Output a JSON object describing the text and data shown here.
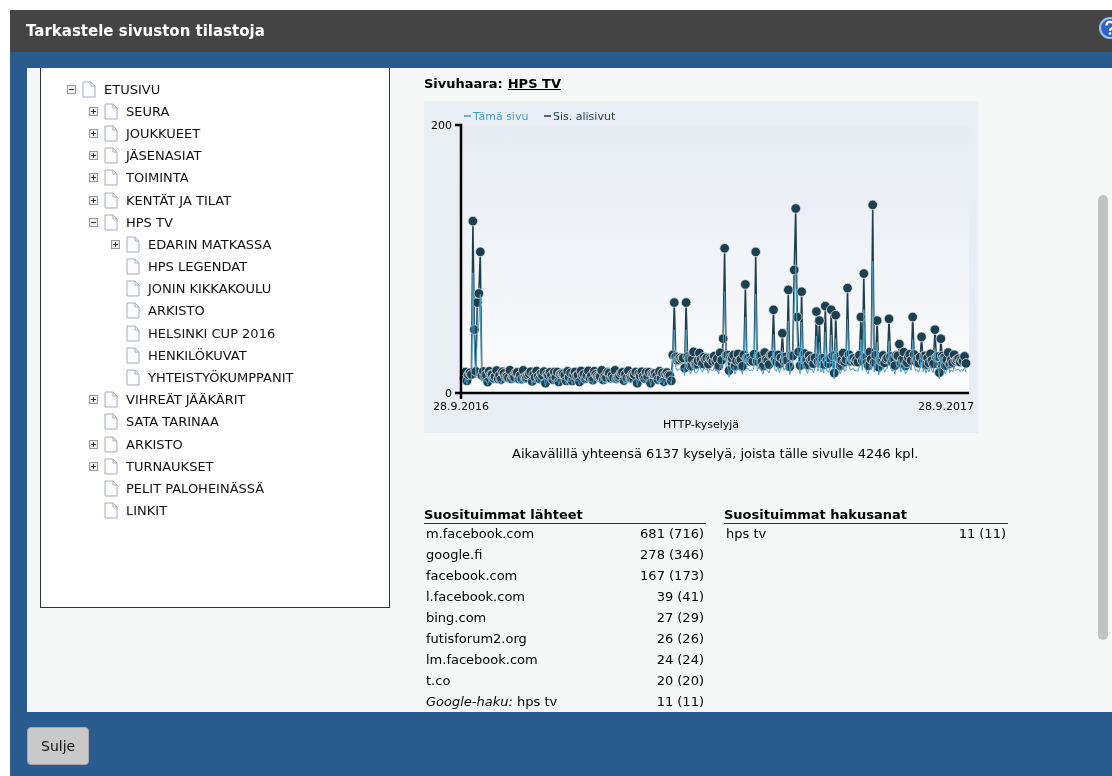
{
  "window": {
    "title": "Tarkastele sivuston tilastoja"
  },
  "tree": [
    {
      "label": "ETUSIVU",
      "kind": "folder",
      "expanded": true,
      "children": [
        {
          "label": "SEURA",
          "kind": "folder",
          "expanded": false
        },
        {
          "label": "JOUKKUEET",
          "kind": "folder",
          "expanded": false
        },
        {
          "label": "JÄSENASIAT",
          "kind": "folder",
          "expanded": false
        },
        {
          "label": "TOIMINTA",
          "kind": "folder",
          "expanded": false
        },
        {
          "label": "KENTÄT JA TILAT",
          "kind": "folder",
          "expanded": false
        },
        {
          "label": "HPS TV",
          "kind": "folder",
          "expanded": true,
          "children": [
            {
              "label": "EDARIN MATKASSA",
              "kind": "folder",
              "expanded": false
            },
            {
              "label": "HPS LEGENDAT",
              "kind": "page"
            },
            {
              "label": "JONIN KIKKAKOULU",
              "kind": "page"
            },
            {
              "label": "ARKISTO",
              "kind": "page"
            },
            {
              "label": "HELSINKI CUP 2016",
              "kind": "page"
            },
            {
              "label": "HENKILÖKUVAT",
              "kind": "page"
            },
            {
              "label": "YHTEISTYÖKUMPPANIT",
              "kind": "page"
            }
          ]
        },
        {
          "label": "VIHREÄT JÄÄKÄRIT",
          "kind": "folder",
          "expanded": false
        },
        {
          "label": "SATA TARINAA",
          "kind": "page"
        },
        {
          "label": "ARKISTO",
          "kind": "folder",
          "expanded": false
        },
        {
          "label": "TURNAUKSET",
          "kind": "folder",
          "expanded": false
        },
        {
          "label": "PELIT PALOHEINÄSSÄ",
          "kind": "page"
        },
        {
          "label": "LINKIT",
          "kind": "page"
        }
      ]
    }
  ],
  "branch": {
    "label": "Sivuhaara:",
    "link": "HPS TV"
  },
  "chart": {
    "legend": [
      {
        "name": "Tämä sivu",
        "color": "#4a9cc4"
      },
      {
        "name": "Sis. alisivut",
        "color": "#1e3f4d"
      }
    ],
    "ymax_label": "200",
    "ymin_label": "0",
    "x_start": "28.9.2016",
    "x_end": "28.9.2017",
    "xlabel": "HTTP-kyselyjä"
  },
  "summary": "Aikavälillä yhteensä 6137 kyselyä, joista tälle sivulle 4246 kpl.",
  "sources": {
    "title": "Suosituimmat lähteet",
    "rows": [
      {
        "name": "m.facebook.com",
        "count": "681 (716)"
      },
      {
        "name": "google.fi",
        "count": "278 (346)"
      },
      {
        "name": "facebook.com",
        "count": "167 (173)"
      },
      {
        "name": "l.facebook.com",
        "count": "39 (41)"
      },
      {
        "name": "bing.com",
        "count": "27 (29)"
      },
      {
        "name": "futisforum2.org",
        "count": "26 (26)"
      },
      {
        "name": "lm.facebook.com",
        "count": "24 (24)"
      },
      {
        "name": "t.co",
        "count": "20 (20)"
      },
      {
        "name": "*Google-haku:* hps tv",
        "count": "11 (11)"
      }
    ]
  },
  "keywords": {
    "title": "Suosituimmat hakusanat",
    "rows": [
      {
        "name": "hps tv",
        "count": "11 (11)"
      }
    ]
  },
  "close_button": "Sulje"
}
